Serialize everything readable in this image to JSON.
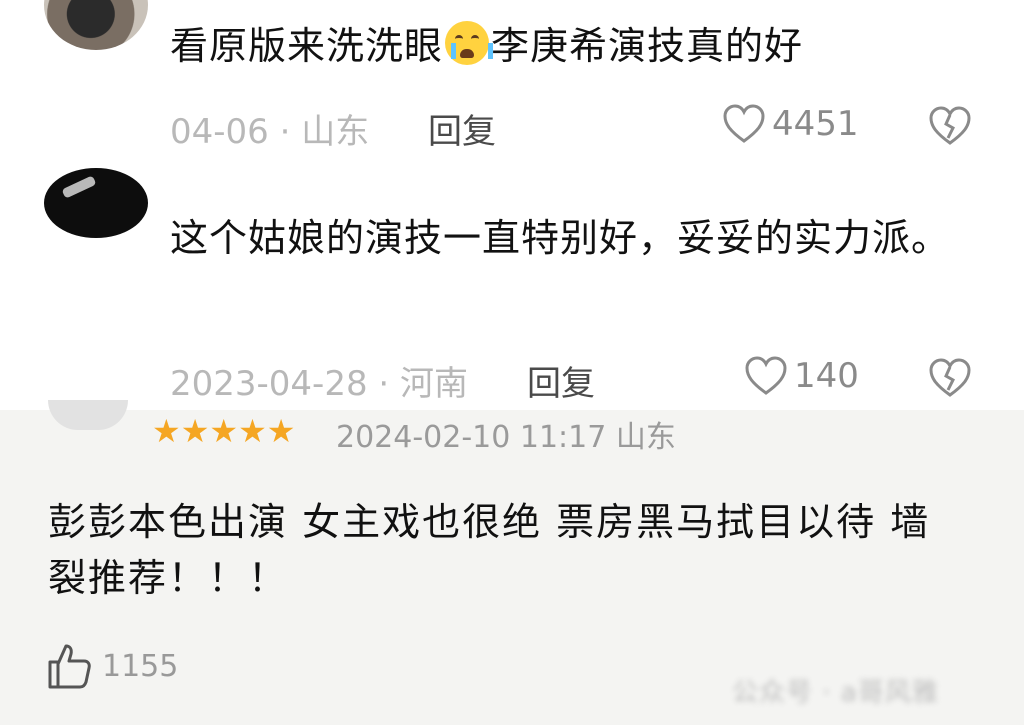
{
  "comments": [
    {
      "text_before": "看原版来洗洗眼",
      "emoji": "loudly-crying-face",
      "text_after": "李庚希演技真的好",
      "meta": "04-06 · 山东",
      "reply_label": "回复",
      "likes": "4451"
    },
    {
      "text": "这个姑娘的演技一直特别好，妥妥的实力派。",
      "meta": "2023-04-28 · 河南",
      "reply_label": "回复",
      "likes": "140"
    }
  ],
  "review": {
    "stars": "★★★★★",
    "rating": 5,
    "datetime": "2024-02-10 11:17 山东",
    "text": "彭彭本色出演 女主戏也很绝 票房黑马拭目以待 墙裂推荐！！！",
    "likes": "1155",
    "watermark": "公众号 · a哥风雅"
  },
  "colors": {
    "star": "#f5a623",
    "meta": "#b8b8b8",
    "review_bg": "#f4f4f2"
  }
}
